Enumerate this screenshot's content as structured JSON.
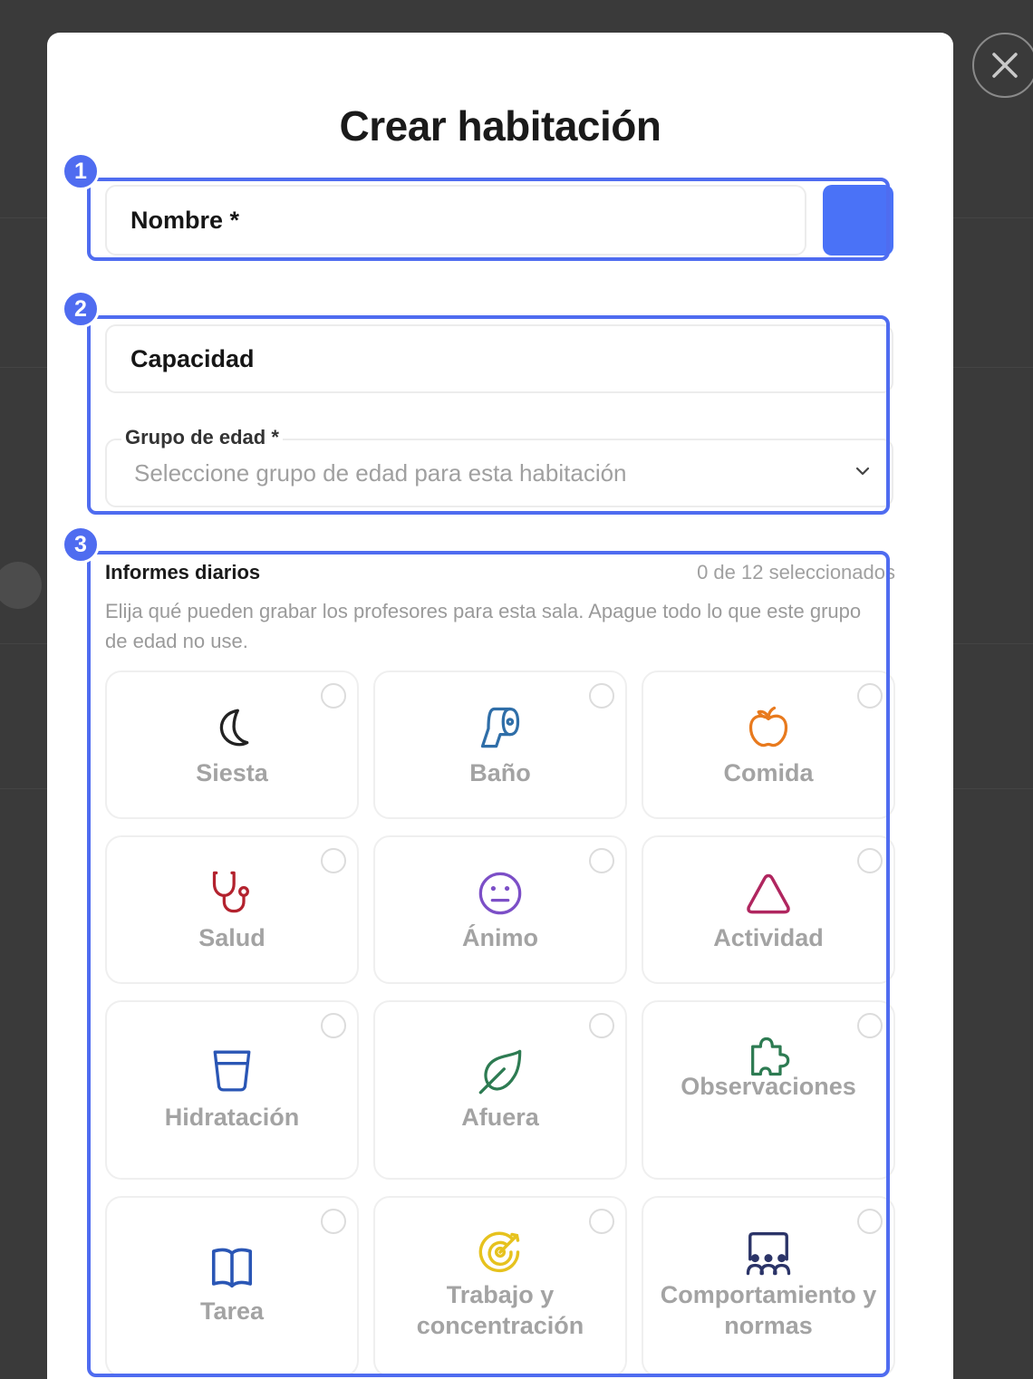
{
  "modal": {
    "title": "Crear habitación",
    "close_label": "×"
  },
  "annotations": [
    "1",
    "2",
    "3"
  ],
  "name_field": {
    "label": "Nombre *",
    "color_value": "#4a72f7"
  },
  "capacity_field": {
    "label": "Capacidad"
  },
  "age_group": {
    "label": "Grupo de edad *",
    "placeholder": "Seleccione grupo de edad para esta habitación"
  },
  "daily_reports": {
    "title": "Informes diarios",
    "counter": "0 de 12 seleccionados",
    "description": "Elija qué pueden grabar los profesores para esta sala. Apague todo lo que este grupo de edad no use.",
    "items": [
      {
        "label": "Siesta",
        "icon": "moon-icon",
        "color": "#222222",
        "selected": false
      },
      {
        "label": "Baño",
        "icon": "toilet-paper-icon",
        "color": "#2f6ea8",
        "selected": false
      },
      {
        "label": "Comida",
        "icon": "apple-icon",
        "color": "#e87a1e",
        "selected": false
      },
      {
        "label": "Salud",
        "icon": "stethoscope-icon",
        "color": "#b3222e",
        "selected": false
      },
      {
        "label": "Ánimo",
        "icon": "neutral-face-icon",
        "color": "#7c4fc7",
        "selected": false
      },
      {
        "label": "Actividad",
        "icon": "triangle-icon",
        "color": "#b0265f",
        "selected": false
      },
      {
        "label": "Hidratación",
        "icon": "glass-icon",
        "color": "#2a56b5",
        "selected": false
      },
      {
        "label": "Afuera",
        "icon": "leaf-icon",
        "color": "#2d7b52",
        "selected": false
      },
      {
        "label": "Observaciones",
        "icon": "puzzle-icon",
        "color": "#2d7b52",
        "selected": false
      },
      {
        "label": "Tarea",
        "icon": "book-icon",
        "color": "#2a56b5",
        "selected": false
      },
      {
        "label": "Trabajo y concentración",
        "icon": "target-icon",
        "color": "#e6c21e",
        "selected": false
      },
      {
        "label": "Comportamiento y normas",
        "icon": "group-icon",
        "color": "#2b3468",
        "selected": false
      }
    ]
  }
}
